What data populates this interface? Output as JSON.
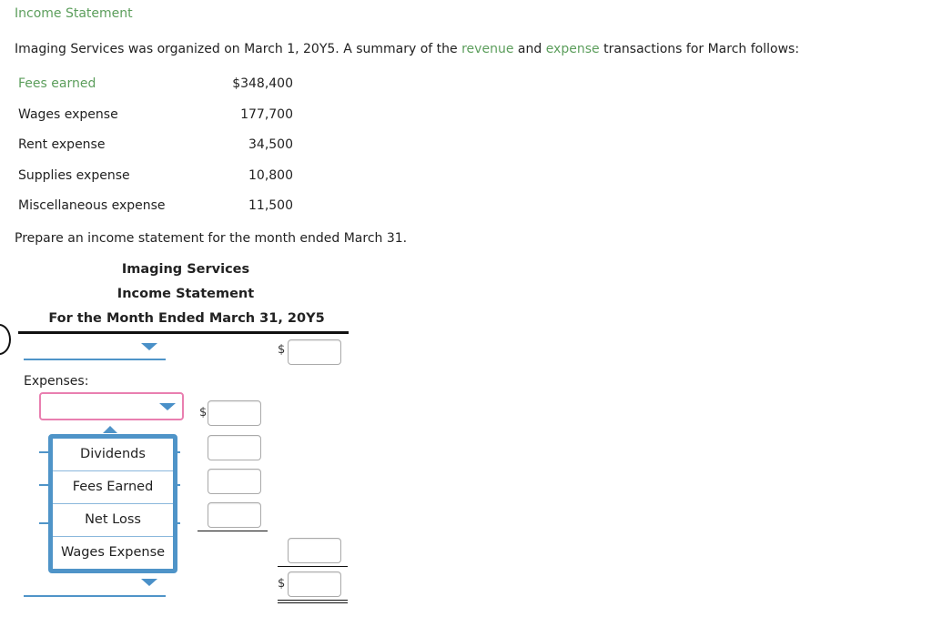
{
  "title": "Income Statement",
  "intro": {
    "before_revenue": "Imaging Services was organized on March 1, 20Y5. A summary of the ",
    "revenue_link": "revenue",
    "and": " and ",
    "expense_link": "expense",
    "after": " transactions for March follows:"
  },
  "transactions": [
    {
      "label": "Fees earned",
      "value": "$348,400"
    },
    {
      "label": "Wages expense",
      "value": "177,700"
    },
    {
      "label": "Rent expense",
      "value": "34,500"
    },
    {
      "label": "Supplies expense",
      "value": "10,800"
    },
    {
      "label": "Miscellaneous expense",
      "value": "11,500"
    }
  ],
  "instruction": "Prepare an income statement for the month ended March 31.",
  "statement": {
    "company": "Imaging Services",
    "name": "Income Statement",
    "period": "For the Month Ended March 31, 20Y5",
    "expenses_label": "Expenses:",
    "dollar": "$"
  },
  "dropdown_options": [
    "Dividends",
    "Fees Earned",
    "Net Loss",
    "Wages Expense"
  ]
}
